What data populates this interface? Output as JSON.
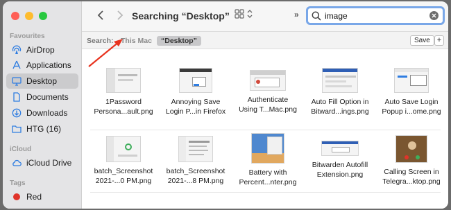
{
  "sidebar": {
    "favourites_heading": "Favourites",
    "favourites": [
      {
        "label": "AirDrop",
        "icon": "airdrop-icon"
      },
      {
        "label": "Applications",
        "icon": "applications-icon"
      },
      {
        "label": "Desktop",
        "icon": "desktop-icon",
        "active": true
      },
      {
        "label": "Documents",
        "icon": "document-icon"
      },
      {
        "label": "Downloads",
        "icon": "download-icon"
      },
      {
        "label": "HTG (16)",
        "icon": "folder-icon"
      }
    ],
    "icloud_heading": "iCloud",
    "icloud": [
      {
        "label": "iCloud Drive",
        "icon": "cloud-icon"
      }
    ],
    "tags_heading": "Tags",
    "tags": [
      {
        "label": "Red",
        "color": "#e0342a"
      }
    ]
  },
  "toolbar": {
    "title": "Searching “Desktop”",
    "more": "»",
    "search": {
      "value": "image",
      "placeholder": "Search"
    }
  },
  "scope": {
    "label": "Search:",
    "this_mac": "This Mac",
    "current": "“Desktop”",
    "save": "Save",
    "add": "+"
  },
  "files": [
    {
      "line1": "1Password",
      "line2": "Persona...ault.png"
    },
    {
      "line1": "Annoying Save",
      "line2": "Login P...in Firefox"
    },
    {
      "line1": "Authenticate",
      "line2": "Using T...Mac.png"
    },
    {
      "line1": "Auto Fill Option in",
      "line2": "Bitward...ings.png"
    },
    {
      "line1": "Auto Save Login",
      "line2": "Popup i...ome.png"
    },
    {
      "line1": "batch_Screenshot",
      "line2": "2021-...0 PM.png"
    },
    {
      "line1": "batch_Screenshot",
      "line2": "2021-...8 PM.png"
    },
    {
      "line1": "Battery with",
      "line2": "Percent...nter.png"
    },
    {
      "line1": "Bitwarden Autofill",
      "line2": "Extension.png"
    },
    {
      "line1": "Calling Screen in",
      "line2": "Telegra...ktop.png"
    }
  ],
  "colors": {
    "accent_focus": "#79a7e8",
    "annotation_arrow": "#e8321e",
    "sidebar_bg": "#e4e4e6"
  }
}
